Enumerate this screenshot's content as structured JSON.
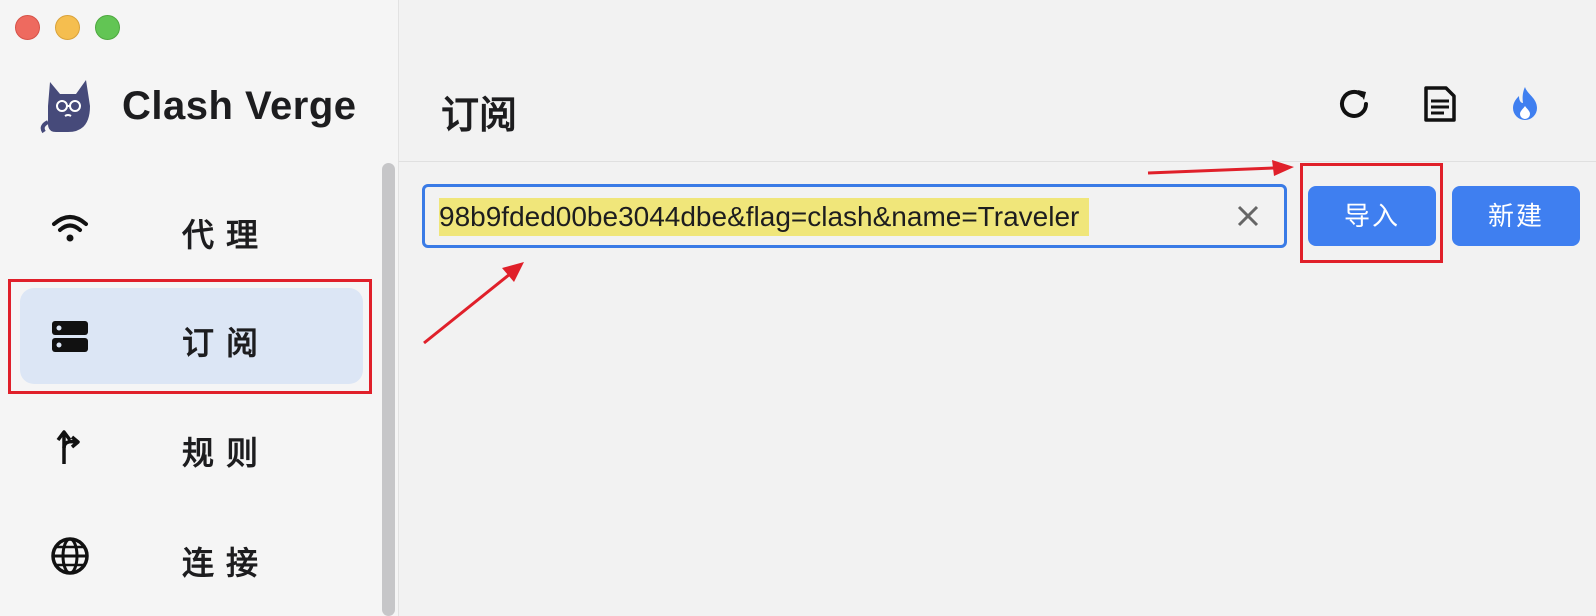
{
  "app": {
    "brand": "Clash Verge"
  },
  "sidebar": {
    "items": [
      {
        "label": "代理",
        "icon": "wifi-icon",
        "active": false
      },
      {
        "label": "订阅",
        "icon": "server-icon",
        "active": true
      },
      {
        "label": "规则",
        "icon": "fork-arrow-icon",
        "active": false
      },
      {
        "label": "连接",
        "icon": "globe-icon",
        "active": false
      }
    ]
  },
  "main": {
    "title": "订阅",
    "header_icons": [
      "refresh-icon",
      "document-icon",
      "flame-icon"
    ],
    "url_input": {
      "value": "98b9fded00be3044dbe&flag=clash&name=Traveler"
    },
    "import_label": "导入",
    "new_label": "新建"
  },
  "colors": {
    "accent": "#3f7ff0",
    "active_nav_bg": "#dce6f5",
    "highlight": "#f0e67a",
    "annotation_red": "#e0202a"
  }
}
